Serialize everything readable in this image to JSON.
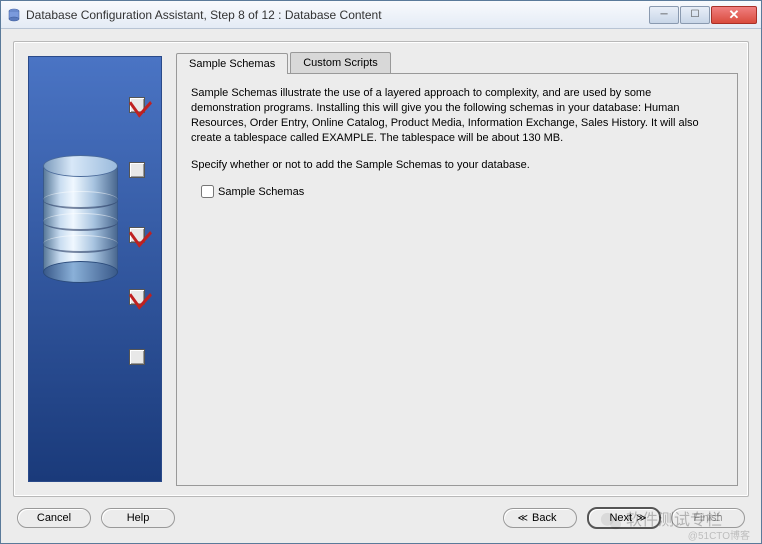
{
  "titlebar": {
    "title": "Database Configuration Assistant, Step 8 of 12 : Database Content"
  },
  "tabs": {
    "sample_schemas": "Sample Schemas",
    "custom_scripts": "Custom Scripts"
  },
  "content": {
    "description": "Sample Schemas illustrate the use of a layered approach to complexity, and are used by some demonstration programs. Installing this will give you the following schemas in your database: Human Resources, Order Entry, Online Catalog, Product Media, Information Exchange, Sales History. It will also create a tablespace called EXAMPLE. The tablespace will be about 130 MB.",
    "prompt": "Specify whether or not to add the Sample Schemas to your database.",
    "checkbox_label": "Sample Schemas"
  },
  "buttons": {
    "cancel": "Cancel",
    "help": "Help",
    "back": "Back",
    "next": "Next",
    "finish": "Finish"
  },
  "watermark": {
    "text": "软件测试专栏",
    "sub": "@51CTO博客"
  }
}
